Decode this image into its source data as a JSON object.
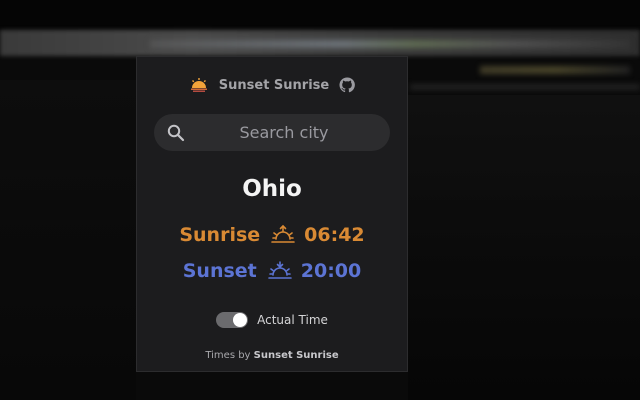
{
  "header": {
    "title": "Sunset Sunrise",
    "logo_icon": "sunset-logo-icon",
    "github_icon": "github-icon"
  },
  "search": {
    "placeholder": "Search city",
    "value": "",
    "icon": "search-icon"
  },
  "location": {
    "city": "Ohio"
  },
  "sunrise": {
    "label": "Sunrise",
    "time": "06:42",
    "icon": "sunrise-icon",
    "color": "#d98a34"
  },
  "sunset": {
    "label": "Sunset",
    "time": "20:00",
    "icon": "sunset-icon",
    "color": "#5c74d4"
  },
  "toggle": {
    "label": "Actual Time",
    "checked": true
  },
  "footer": {
    "prefix": "Times by",
    "brand": "Sunset Sunrise"
  }
}
